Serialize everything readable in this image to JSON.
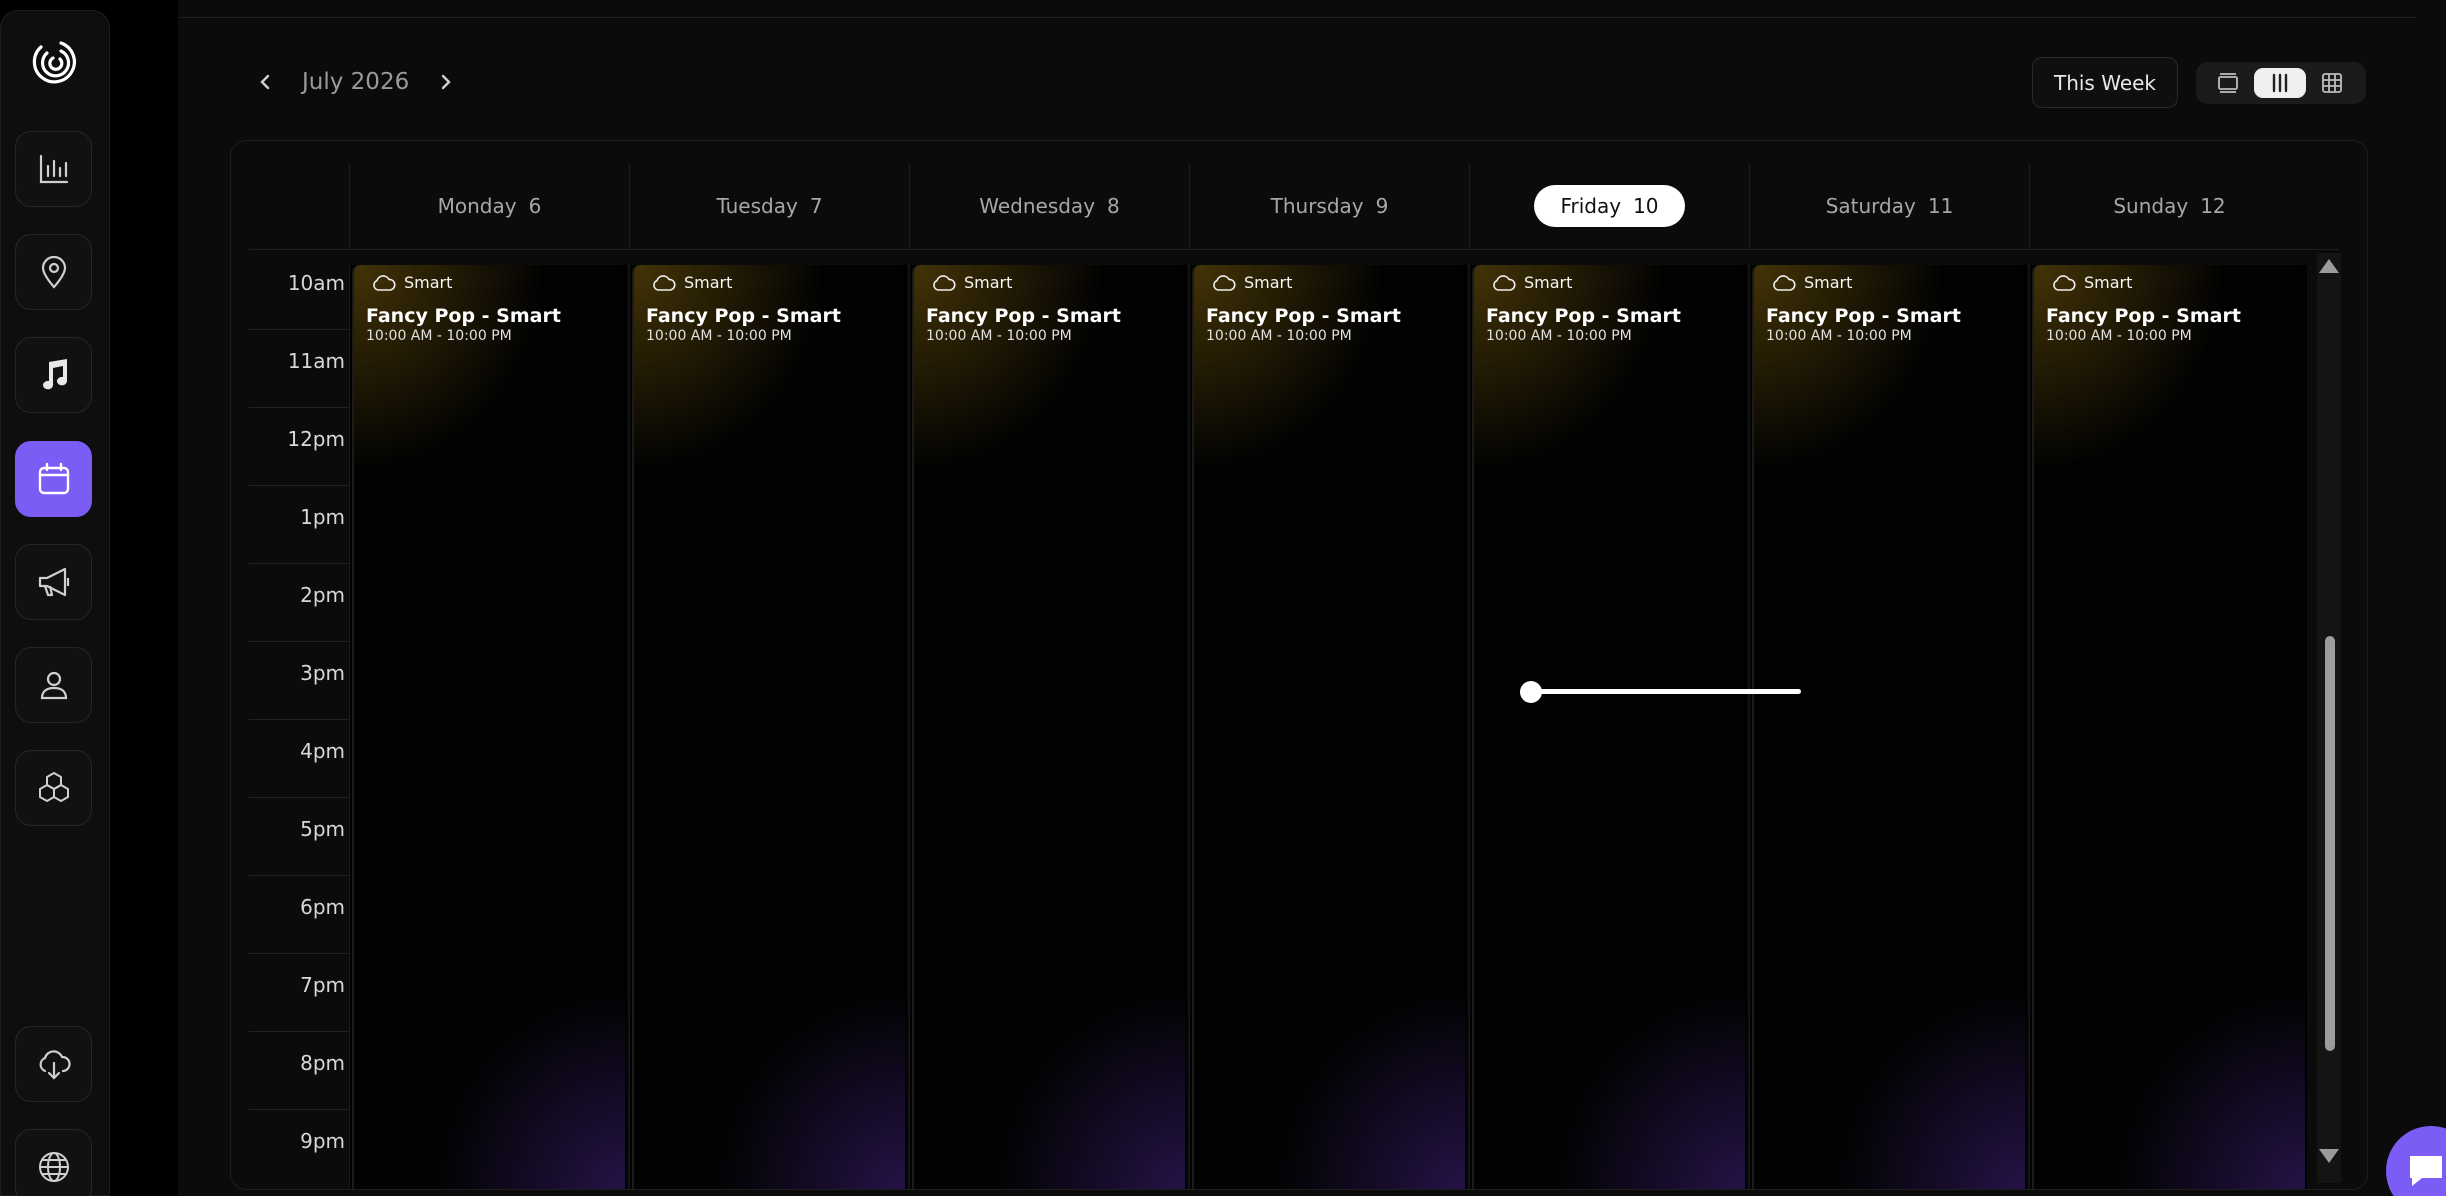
{
  "sidebar": {
    "items": [
      {
        "name": "analytics",
        "icon": "bar-chart-icon",
        "active": false
      },
      {
        "name": "locations",
        "icon": "location-pin-icon",
        "active": false
      },
      {
        "name": "music",
        "icon": "music-note-icon",
        "active": false
      },
      {
        "name": "schedule",
        "icon": "calendar-icon",
        "active": true
      },
      {
        "name": "announcements",
        "icon": "megaphone-icon",
        "active": false
      },
      {
        "name": "users",
        "icon": "user-icon",
        "active": false
      },
      {
        "name": "integrations",
        "icon": "cubes-icon",
        "active": false
      }
    ],
    "bottom_items": [
      {
        "name": "download",
        "icon": "cloud-download-icon"
      },
      {
        "name": "language",
        "icon": "globe-icon"
      }
    ]
  },
  "calendar": {
    "month_label": "July 2026",
    "this_week_label": "This Week",
    "views": [
      "day-view",
      "week-view",
      "month-view"
    ],
    "active_view": "week-view",
    "days": [
      {
        "name": "Monday",
        "num": "6",
        "today": false
      },
      {
        "name": "Tuesday",
        "num": "7",
        "today": false
      },
      {
        "name": "Wednesday",
        "num": "8",
        "today": false
      },
      {
        "name": "Thursday",
        "num": "9",
        "today": false
      },
      {
        "name": "Friday",
        "num": "10",
        "today": true
      },
      {
        "name": "Saturday",
        "num": "11",
        "today": false
      },
      {
        "name": "Sunday",
        "num": "12",
        "today": false
      }
    ],
    "hours": [
      "10am",
      "11am",
      "12pm",
      "1pm",
      "2pm",
      "3pm",
      "4pm",
      "5pm",
      "6pm",
      "7pm",
      "8pm",
      "9pm"
    ],
    "events": [
      {
        "tag": "Smart",
        "title": "Fancy Pop - Smart",
        "time": "10:00 AM - 10:00 PM"
      },
      {
        "tag": "Smart",
        "title": "Fancy Pop - Smart",
        "time": "10:00 AM - 10:00 PM"
      },
      {
        "tag": "Smart",
        "title": "Fancy Pop - Smart",
        "time": "10:00 AM - 10:00 PM"
      },
      {
        "tag": "Smart",
        "title": "Fancy Pop - Smart",
        "time": "10:00 AM - 10:00 PM"
      },
      {
        "tag": "Smart",
        "title": "Fancy Pop - Smart",
        "time": "10:00 AM - 10:00 PM"
      },
      {
        "tag": "Smart",
        "title": "Fancy Pop - Smart",
        "time": "10:00 AM - 10:00 PM"
      },
      {
        "tag": "Smart",
        "title": "Fancy Pop - Smart",
        "time": "10:00 AM - 10:00 PM"
      }
    ]
  },
  "colors": {
    "accent": "#7b5cf5",
    "background": "#000000",
    "panel": "#0b0b0b"
  }
}
